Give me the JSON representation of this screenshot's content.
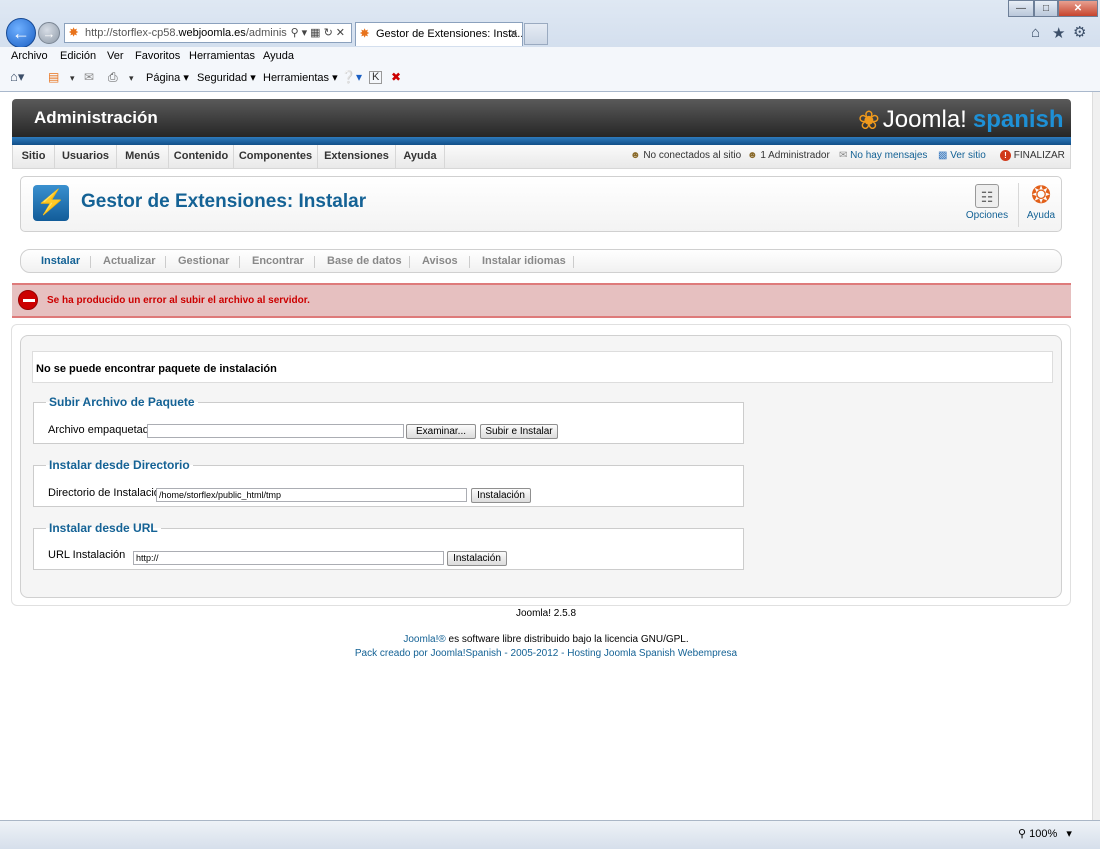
{
  "browser": {
    "address_prefix": "http://storflex-cp58.",
    "address_domain": "webjoomla.es",
    "address_suffix": "/adminis",
    "tab_title": "Gestor de Extensiones: Insta...",
    "menu": [
      "Archivo",
      "Edición",
      "Ver",
      "Favoritos",
      "Herramientas",
      "Ayuda"
    ],
    "cmd": {
      "pagina": "Página",
      "seguridad": "Seguridad",
      "herramientas": "Herramientas"
    },
    "zoom": "100%"
  },
  "joomla": {
    "admin_title": "Administración",
    "logo_text": "Joomla!",
    "logo_spanish": "spanish",
    "menu": [
      "Sitio",
      "Usuarios",
      "Menús",
      "Contenido",
      "Componentes",
      "Extensiones",
      "Ayuda"
    ],
    "status": {
      "not_connected": "No conectados al sitio",
      "admins": "1 Administrador",
      "messages": "No hay mensajes",
      "view_site": "Ver sitio",
      "logout": "FINALIZAR"
    },
    "toolbar": {
      "title": "Gestor de Extensiones: Instalar",
      "options": "Opciones",
      "help": "Ayuda"
    },
    "submenu": [
      "Instalar",
      "Actualizar",
      "Gestionar",
      "Encontrar",
      "Base de datos",
      "Avisos",
      "Instalar idiomas"
    ],
    "error": "Se ha producido un error al subir el archivo al servidor.",
    "no_package": "No se puede encontrar paquete de instalación",
    "upload": {
      "legend": "Subir Archivo de Paquete",
      "label": "Archivo empaquetado",
      "browse": "Examinar...",
      "submit": "Subir e Instalar"
    },
    "directory": {
      "legend": "Instalar desde Directorio",
      "label": "Directorio de Instalación",
      "value": "/home/storflex/public_html/tmp",
      "submit": "Instalación"
    },
    "url": {
      "legend": "Instalar desde URL",
      "label": "URL Instalación",
      "value": "http://",
      "submit": "Instalación"
    },
    "footer": {
      "version": "Joomla! 2.5.8",
      "license_link": "Joomla!®",
      "license_text": " es software libre distribuido bajo la licencia GNU/GPL.",
      "pack": "Pack creado por Joomla!Spanish - 2005-2012 - Hosting Joomla Spanish Webempresa"
    }
  }
}
